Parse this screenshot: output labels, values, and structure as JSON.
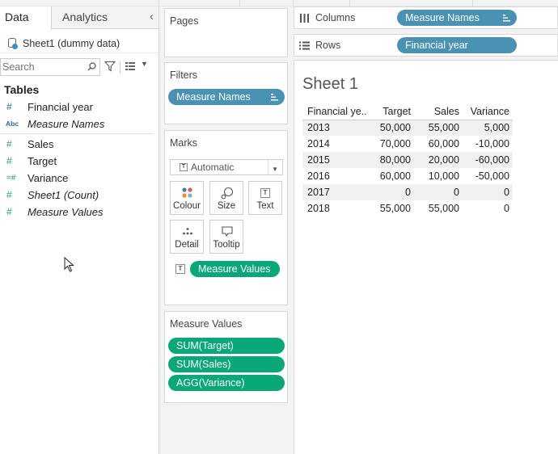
{
  "left_pane": {
    "tabs": {
      "data": "Data",
      "analytics": "Analytics"
    },
    "datasource": "Sheet1 (dummy data)",
    "search_placeholder": "Search",
    "tables_title": "Tables",
    "dimensions": [
      {
        "icon": "number-icon",
        "glyph": "#",
        "label": "Financial year",
        "italic": false
      },
      {
        "icon": "text-abc-icon",
        "glyph": "Abc",
        "label": "Measure Names",
        "italic": true
      }
    ],
    "measures": [
      {
        "icon": "number-icon",
        "glyph": "#",
        "label": "Sales",
        "italic": false
      },
      {
        "icon": "number-icon",
        "glyph": "#",
        "label": "Target",
        "italic": false
      },
      {
        "icon": "calculated-number-icon",
        "glyph": "=#",
        "label": "Variance",
        "italic": false
      },
      {
        "icon": "number-icon",
        "glyph": "#",
        "label": "Sheet1 (Count)",
        "italic": true
      },
      {
        "icon": "number-icon",
        "glyph": "#",
        "label": "Measure Values",
        "italic": true
      }
    ]
  },
  "cards": {
    "pages_title": "Pages",
    "filters_title": "Filters",
    "filters_pill": "Measure Names",
    "marks_title": "Marks",
    "marks_type": "Automatic",
    "marks_buttons": {
      "colour": "Colour",
      "size": "Size",
      "text": "Text",
      "detail": "Detail",
      "tooltip": "Tooltip"
    },
    "marks_text_pill": "Measure Values",
    "measure_values_title": "Measure Values",
    "measure_values_pills": [
      "SUM(Target)",
      "SUM(Sales)",
      "AGG(Variance)"
    ]
  },
  "shelves": {
    "columns_label": "Columns",
    "columns_pill": "Measure Names",
    "rows_label": "Rows",
    "rows_pill": "Financial year"
  },
  "view": {
    "sheet_title": "Sheet 1",
    "headers": [
      "Financial ye..",
      "Target",
      "Sales",
      "Variance"
    ],
    "rows": [
      [
        "2013",
        "50,000",
        "55,000",
        "5,000"
      ],
      [
        "2014",
        "70,000",
        "60,000",
        "-10,000"
      ],
      [
        "2015",
        "80,000",
        "20,000",
        "-60,000"
      ],
      [
        "2016",
        "60,000",
        "10,000",
        "-50,000"
      ],
      [
        "2017",
        "0",
        "0",
        "0"
      ],
      [
        "2018",
        "55,000",
        "55,000",
        "0"
      ]
    ]
  },
  "colors": {
    "dimension_pill": "#4a92b4",
    "measure_pill": "#0aa778",
    "row_shading": "#f0f0f0"
  }
}
